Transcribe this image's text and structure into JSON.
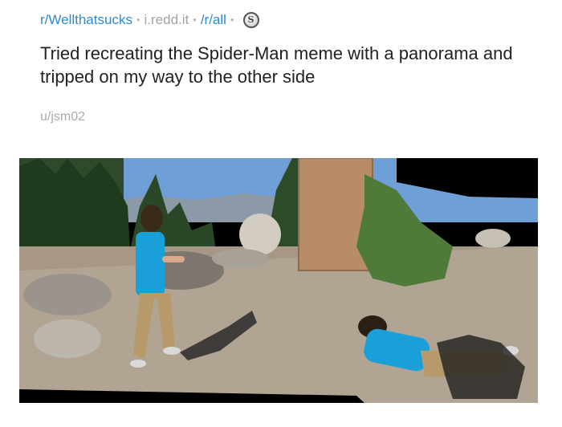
{
  "post": {
    "subreddit": "r/Wellthatsucks",
    "domain": "i.redd.it",
    "crosspost": "/r/all",
    "award_icon": "silver-award-icon",
    "award_glyph": "S",
    "title": "Tried recreating the Spider-Man meme with a panorama and tripped on my way to the other side",
    "author": "u/jsm02"
  },
  "colors": {
    "link": "#2a8ad4",
    "muted": "#a3a3a3",
    "title": "#222222"
  }
}
